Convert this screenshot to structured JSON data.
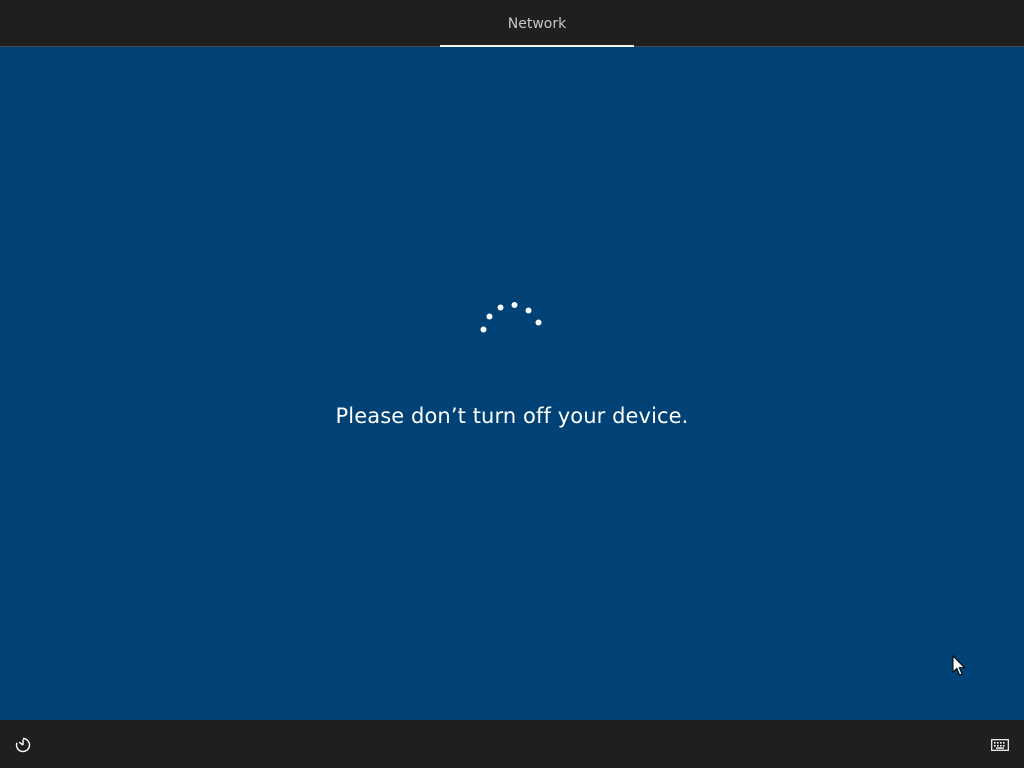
{
  "header": {
    "tabs": [
      {
        "label": "Network",
        "active": true
      }
    ]
  },
  "main": {
    "message": "Please don’t turn off your device.",
    "spinner": {
      "state": "loading",
      "dot_count": 6
    }
  },
  "footer": {
    "left_icon": "ease-of-access-icon",
    "right_icon": "keyboard-icon"
  },
  "colors": {
    "background": "#004275",
    "bars": "#1f1f1f",
    "text": "#ffffff",
    "tab_text": "#c8c8c8"
  }
}
